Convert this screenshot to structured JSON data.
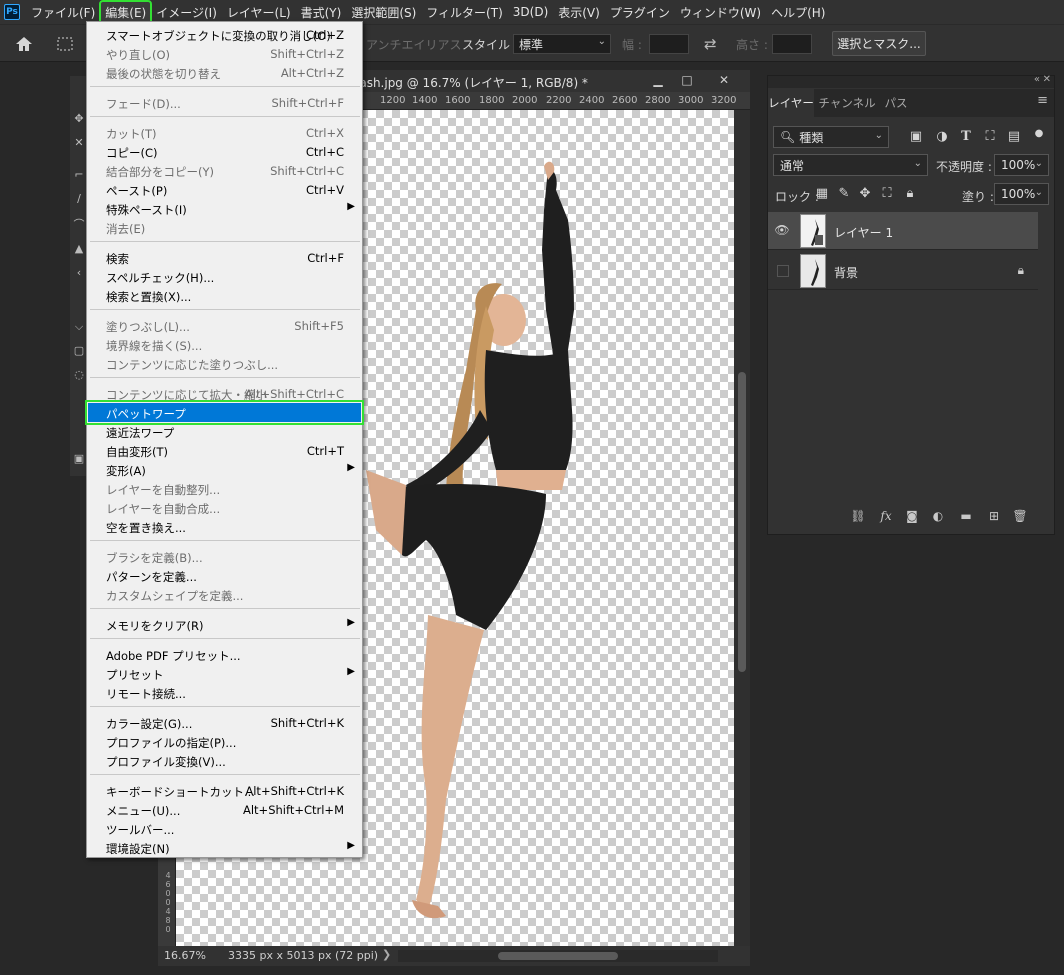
{
  "menubar": {
    "logo": "Ps",
    "items": [
      {
        "label": "ファイル(F)"
      },
      {
        "label": "編集(E)"
      },
      {
        "label": "イメージ(I)"
      },
      {
        "label": "レイヤー(L)"
      },
      {
        "label": "書式(Y)"
      },
      {
        "label": "選択範囲(S)"
      },
      {
        "label": "フィルター(T)"
      },
      {
        "label": "3D(D)"
      },
      {
        "label": "表示(V)"
      },
      {
        "label": "プラグイン"
      },
      {
        "label": "ウィンドウ(W)"
      },
      {
        "label": "ヘルプ(H)"
      }
    ]
  },
  "options_bar": {
    "antialias": "アンチエイリアス",
    "style_label": "スタイル :",
    "style_value": "標準",
    "width_label": "幅 :",
    "height_label": "高さ :",
    "select_mask_button": "選択とマスク..."
  },
  "document": {
    "title": "lash.jpg @ 16.7% (レイヤー 1, RGB/8) *",
    "ruler_ticks": [
      "1200",
      "1400",
      "1600",
      "1800",
      "2000",
      "2200",
      "2400",
      "2600",
      "2800",
      "3000",
      "3200"
    ],
    "left_ruler_digits": [
      "4",
      "6",
      "0",
      "0",
      "4",
      "8",
      "0"
    ],
    "zoom": "16.67%",
    "info": "3335 px x 5013 px (72 ppi)",
    "status_arrow": "❯"
  },
  "edit_menu": {
    "items": [
      {
        "label": "スマートオブジェクトに変換の取り消し(O)",
        "shortcut": "Ctrl+Z",
        "enabled": true
      },
      {
        "label": "やり直し(O)",
        "shortcut": "Shift+Ctrl+Z",
        "enabled": false
      },
      {
        "label": "最後の状態を切り替え",
        "shortcut": "Alt+Ctrl+Z",
        "enabled": false
      },
      {
        "label": "フェード(D)...",
        "shortcut": "Shift+Ctrl+F",
        "enabled": false
      },
      {
        "label": "カット(T)",
        "shortcut": "Ctrl+X",
        "enabled": false
      },
      {
        "label": "コピー(C)",
        "shortcut": "Ctrl+C",
        "enabled": true
      },
      {
        "label": "結合部分をコピー(Y)",
        "shortcut": "Shift+Ctrl+C",
        "enabled": false
      },
      {
        "label": "ペースト(P)",
        "shortcut": "Ctrl+V",
        "enabled": true
      },
      {
        "label": "特殊ペースト(I)",
        "shortcut": "",
        "enabled": true,
        "submenu": true
      },
      {
        "label": "消去(E)",
        "shortcut": "",
        "enabled": false
      },
      {
        "label": "検索",
        "shortcut": "Ctrl+F",
        "enabled": true
      },
      {
        "label": "スペルチェック(H)...",
        "shortcut": "",
        "enabled": true
      },
      {
        "label": "検索と置換(X)...",
        "shortcut": "",
        "enabled": true
      },
      {
        "label": "塗りつぶし(L)...",
        "shortcut": "Shift+F5",
        "enabled": false
      },
      {
        "label": "境界線を描く(S)...",
        "shortcut": "",
        "enabled": false
      },
      {
        "label": "コンテンツに応じた塗りつぶし...",
        "shortcut": "",
        "enabled": false
      },
      {
        "label": "コンテンツに応じて拡大・縮小",
        "shortcut": "Alt+Shift+Ctrl+C",
        "enabled": false
      },
      {
        "label": "パペットワープ",
        "shortcut": "",
        "enabled": true,
        "highlighted": true
      },
      {
        "label": "遠近法ワープ",
        "shortcut": "",
        "enabled": true
      },
      {
        "label": "自由変形(T)",
        "shortcut": "Ctrl+T",
        "enabled": true
      },
      {
        "label": "変形(A)",
        "shortcut": "",
        "enabled": true,
        "submenu": true
      },
      {
        "label": "レイヤーを自動整列...",
        "shortcut": "",
        "enabled": false
      },
      {
        "label": "レイヤーを自動合成...",
        "shortcut": "",
        "enabled": false
      },
      {
        "label": "空を置き換え...",
        "shortcut": "",
        "enabled": true
      },
      {
        "label": "ブラシを定義(B)...",
        "shortcut": "",
        "enabled": false
      },
      {
        "label": "パターンを定義...",
        "shortcut": "",
        "enabled": true
      },
      {
        "label": "カスタムシェイプを定義...",
        "shortcut": "",
        "enabled": false
      },
      {
        "label": "メモリをクリア(R)",
        "shortcut": "",
        "enabled": true,
        "submenu": true
      },
      {
        "label": "Adobe PDF プリセット...",
        "shortcut": "",
        "enabled": true
      },
      {
        "label": "プリセット",
        "shortcut": "",
        "enabled": true,
        "submenu": true
      },
      {
        "label": "リモート接続...",
        "shortcut": "",
        "enabled": true
      },
      {
        "label": "カラー設定(G)...",
        "shortcut": "Shift+Ctrl+K",
        "enabled": true
      },
      {
        "label": "プロファイルの指定(P)...",
        "shortcut": "",
        "enabled": true
      },
      {
        "label": "プロファイル変換(V)...",
        "shortcut": "",
        "enabled": true
      },
      {
        "label": "キーボードショートカット...",
        "shortcut": "Alt+Shift+Ctrl+K",
        "enabled": true
      },
      {
        "label": "メニュー(U)...",
        "shortcut": "Alt+Shift+Ctrl+M",
        "enabled": true
      },
      {
        "label": "ツールバー...",
        "shortcut": "",
        "enabled": true
      },
      {
        "label": "環境設定(N)",
        "shortcut": "",
        "enabled": true,
        "submenu": true
      }
    ]
  },
  "layers_panel": {
    "tabs": [
      "レイヤー",
      "チャンネル",
      "パス"
    ],
    "filter_kind": "種類",
    "blend_mode": "通常",
    "opacity_label": "不透明度 :",
    "opacity_value": "100%",
    "lock_label": "ロック :",
    "fill_label": "塗り :",
    "fill_value": "100%",
    "layers": [
      {
        "name": "レイヤー 1",
        "visible": true,
        "selected": true,
        "locked": false
      },
      {
        "name": "背景",
        "visible": false,
        "selected": false,
        "locked": true
      }
    ]
  },
  "colors": {
    "accent_highlight": "#0078d7",
    "annotation_green": "#33e033"
  }
}
